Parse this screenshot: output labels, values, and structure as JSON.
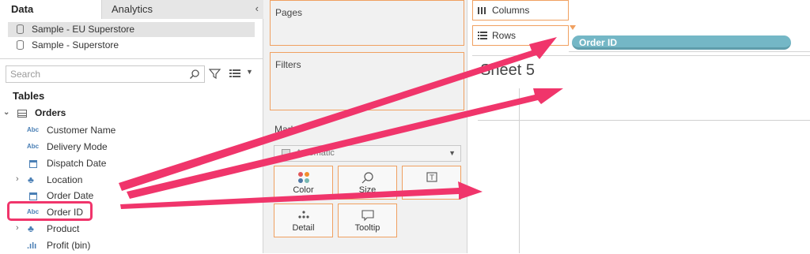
{
  "data_pane": {
    "tabs": {
      "data": "Data",
      "analytics": "Analytics"
    },
    "data_sources": [
      "Sample - EU Superstore",
      "Sample - Superstore"
    ],
    "search_placeholder": "Search",
    "tables_heading": "Tables",
    "table_name": "Orders",
    "fields": [
      {
        "label": "Customer Name",
        "type": "Abc"
      },
      {
        "label": "Delivery Mode",
        "type": "Abc"
      },
      {
        "label": "Dispatch Date",
        "type": "date"
      },
      {
        "label": "Location",
        "type": "hierarchy"
      },
      {
        "label": "Order Date",
        "type": "date"
      },
      {
        "label": "Order ID",
        "type": "Abc"
      },
      {
        "label": "Product",
        "type": "hierarchy"
      },
      {
        "label": "Profit (bin)",
        "type": "bins"
      }
    ]
  },
  "cards": {
    "pages": "Pages",
    "filters": "Filters",
    "marks": "Marks"
  },
  "marks": {
    "type_selected": "Automatic",
    "buttons": {
      "color": "Color",
      "size": "Size",
      "text": "",
      "detail": "Detail",
      "tooltip": "Tooltip"
    }
  },
  "shelves": {
    "columns": "Columns",
    "rows": "Rows",
    "rows_pill": "Order ID"
  },
  "sheet": {
    "title": "Sheet 5"
  },
  "colors": {
    "accent_orange": "#f0a060",
    "pill": "#74b7c6",
    "annotation": "#f0356b"
  }
}
